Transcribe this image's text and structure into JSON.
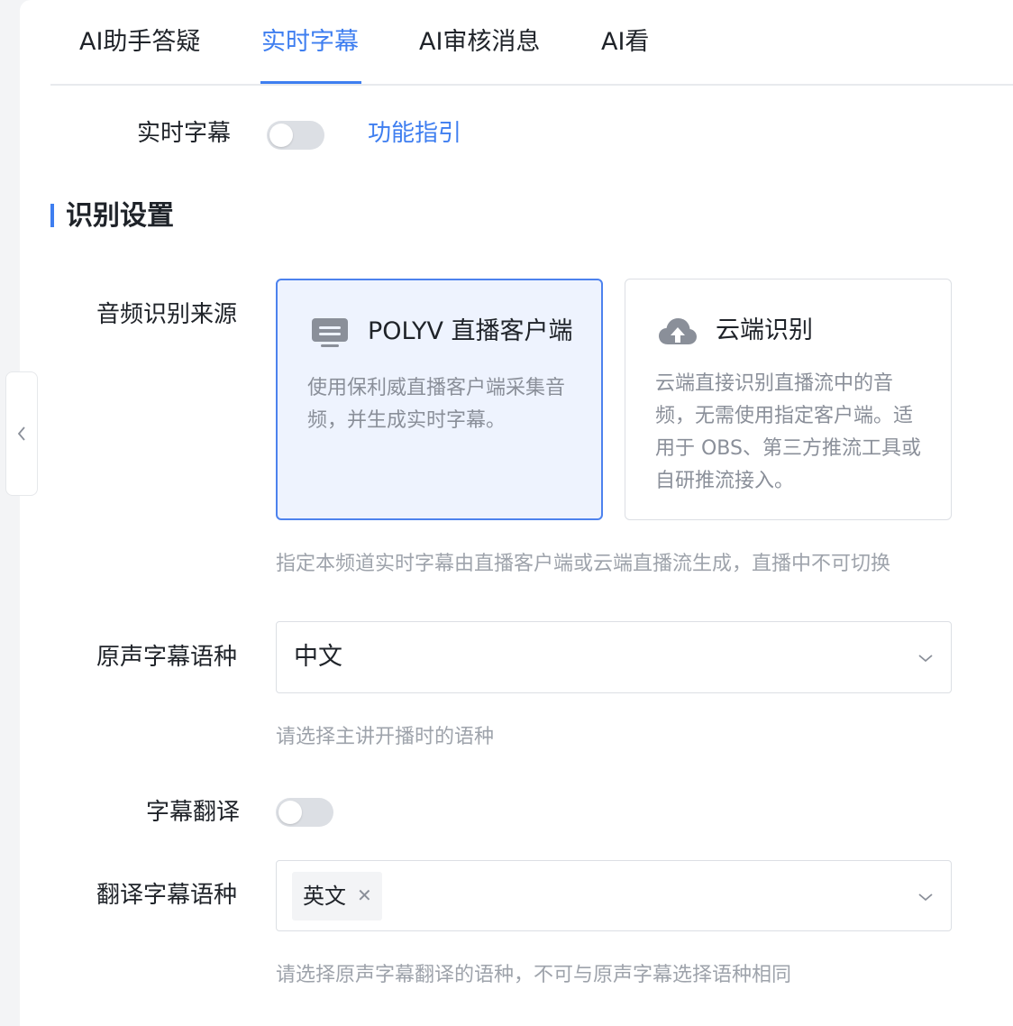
{
  "tabs": [
    {
      "label": "AI助手答疑"
    },
    {
      "label": "实时字幕"
    },
    {
      "label": "AI审核消息"
    },
    {
      "label": "AI看"
    }
  ],
  "active_tab": "实时字幕",
  "realtime_subtitle": {
    "label": "实时字幕",
    "enabled": false,
    "guide_link": "功能指引"
  },
  "section": {
    "title": "识别设置"
  },
  "audio_source": {
    "label": "音频识别来源",
    "options": [
      {
        "title": "POLYV 直播客户端",
        "desc": "使用保利威直播客户端采集音频，并生成实时字幕。",
        "icon": "monitor-icon",
        "selected": true
      },
      {
        "title": "云端识别",
        "desc": "云端直接识别直播流中的音频，无需使用指定客户端。适用于 OBS、第三方推流工具或自研推流接入。",
        "icon": "cloud-upload-icon",
        "selected": false
      }
    ],
    "hint": "指定本频道实时字幕由直播客户端或云端直播流生成，直播中不可切换"
  },
  "source_language": {
    "label": "原声字幕语种",
    "value": "中文",
    "hint": "请选择主讲开播时的语种"
  },
  "subtitle_translation": {
    "label": "字幕翻译",
    "enabled": false
  },
  "target_language": {
    "label": "翻译字幕语种",
    "tags": [
      "英文"
    ],
    "hint": "请选择原声字幕翻译的语种，不可与原声字幕选择语种相同"
  },
  "colors": {
    "accent": "#3e7ef0",
    "selected_card_bg": "#eef3fe",
    "hint_text": "#9ea3ab",
    "switch_off": "#dcdfe4"
  }
}
